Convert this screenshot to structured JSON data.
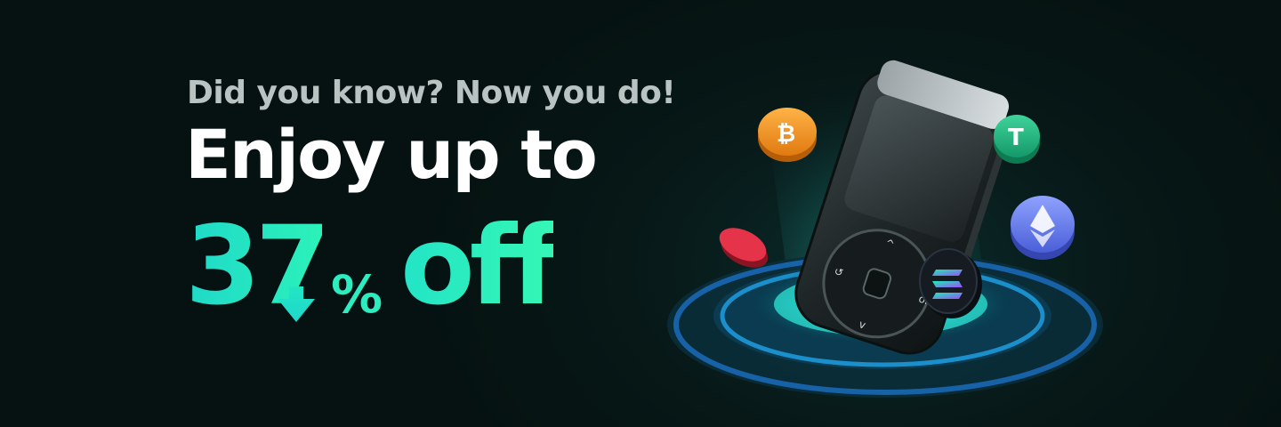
{
  "banner": {
    "kicker": "Did you know? Now you do!",
    "headline": "Enjoy up to",
    "offer_number": "37",
    "offer_percent": "%",
    "offer_suffix": "off"
  },
  "colors": {
    "background": "#061514",
    "kicker": "#b9c3c2",
    "headline": "#ffffff",
    "accent_start": "#1fd9c9",
    "accent_end": "#35f7b5"
  },
  "icons": [
    "down-arrow-icon",
    "hardware-wallet-device",
    "bitcoin-coin-icon",
    "tether-coin-icon",
    "ethereum-coin-icon",
    "solana-coin-icon",
    "red-token-coin-icon"
  ]
}
